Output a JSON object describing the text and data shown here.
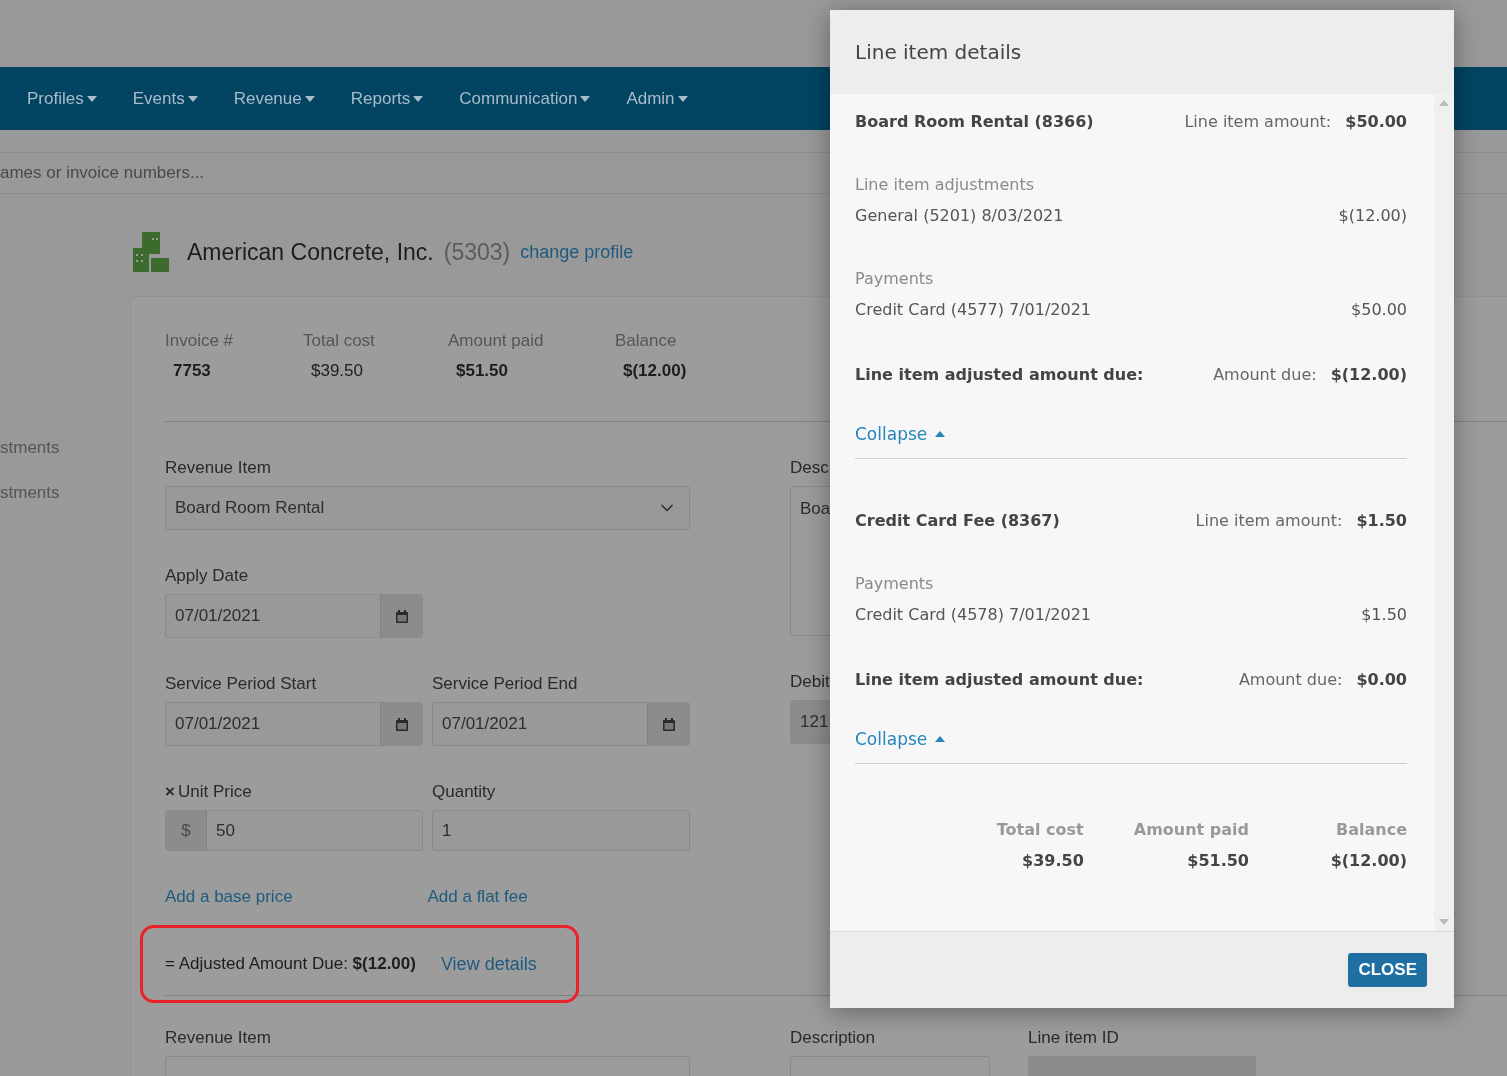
{
  "nav": {
    "items": [
      {
        "label": "Profiles"
      },
      {
        "label": "Events"
      },
      {
        "label": "Revenue"
      },
      {
        "label": "Reports"
      },
      {
        "label": "Communication"
      },
      {
        "label": "Admin"
      }
    ]
  },
  "search": {
    "placeholder": "ames or invoice numbers..."
  },
  "sidebar": {
    "items": [
      {
        "label": "stments"
      },
      {
        "label": "stments"
      }
    ]
  },
  "profile": {
    "name": "American Concrete, Inc.",
    "number": "(5303)",
    "link": "change profile"
  },
  "invoice_summary": [
    {
      "label": "Invoice #",
      "value": "7753",
      "bold": true
    },
    {
      "label": "Total cost",
      "value": "$39.50",
      "bold": false
    },
    {
      "label": "Amount paid",
      "value": "$51.50",
      "bold": true
    },
    {
      "label": "Balance",
      "value": "$(12.00)",
      "bold": true
    }
  ],
  "line_item": {
    "revenue_item": {
      "label": "Revenue Item",
      "value": "Board Room Rental"
    },
    "apply_date": {
      "label": "Apply Date",
      "value": "07/01/2021"
    },
    "service_start": {
      "label": "Service Period Start",
      "value": "07/01/2021"
    },
    "service_end": {
      "label": "Service Period End",
      "value": "07/01/2021"
    },
    "unit_price": {
      "marker": "×",
      "label": "Unit Price",
      "prefix": "$",
      "value": "50"
    },
    "quantity": {
      "label": "Quantity",
      "value": "1"
    },
    "links": [
      "Add a base price",
      "Add a flat fee"
    ],
    "adjusted_due": {
      "label": "= Adjusted Amount Due:",
      "amount": "$(12.00)",
      "link": "View details"
    },
    "description": {
      "label": "Desc",
      "value": "Boa"
    },
    "debit": {
      "label": "Debit",
      "value": "121"
    }
  },
  "next_line_item": {
    "revenue_label": "Revenue Item",
    "description_label": "Description",
    "id_label": "Line item ID"
  },
  "modal": {
    "title": "Line item details",
    "sections": [
      {
        "name": "Board Room Rental (8366)",
        "amount_label": "Line item amount:",
        "amount": "$50.00",
        "groups": [
          {
            "heading": "Line item adjustments",
            "entries": [
              {
                "text": "General (5201) 8/03/2021",
                "amount": "$(12.00)"
              }
            ]
          },
          {
            "heading": "Payments",
            "entries": [
              {
                "text": "Credit Card (4577) 7/01/2021",
                "amount": "$50.00"
              }
            ]
          }
        ],
        "due_label": "Line item adjusted amount due:",
        "due_amount_label": "Amount due:",
        "due_amount": "$(12.00)",
        "toggle": "Collapse"
      },
      {
        "name": "Credit Card Fee (8367)",
        "amount_label": "Line item amount:",
        "amount": "$1.50",
        "groups": [
          {
            "heading": "Payments",
            "entries": [
              {
                "text": "Credit Card (4578) 7/01/2021",
                "amount": "$1.50"
              }
            ]
          }
        ],
        "due_label": "Line item adjusted amount due:",
        "due_amount_label": "Amount due:",
        "due_amount": "$0.00",
        "toggle": "Collapse"
      }
    ],
    "totals": [
      {
        "label": "Total cost",
        "value": "$39.50"
      },
      {
        "label": "Amount paid",
        "value": "$51.50"
      },
      {
        "label": "Balance",
        "value": "$(12.00)"
      }
    ],
    "close": "CLOSE"
  }
}
